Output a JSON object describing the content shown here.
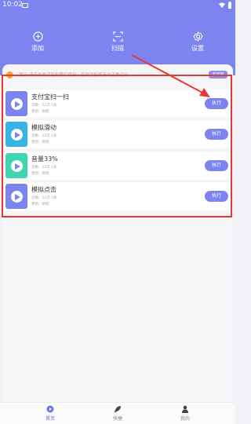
{
  "status_bar": {
    "time": "10:02"
  },
  "header": {
    "actions": [
      {
        "label": "添加",
        "icon": "plus-circle-icon"
      },
      {
        "label": "扫描",
        "icon": "scan-icon"
      },
      {
        "label": "设置",
        "icon": "gear-icon"
      }
    ]
  },
  "notice": {
    "text": "提示:请开启悬浮窗权限后使用，否则功能将无法正常运行",
    "button_label": "去开启"
  },
  "scripts": [
    {
      "title": "支付宝扫一扫",
      "meta1": "次数：12次  1条",
      "meta2": "更新：刚刚",
      "run_label": "执行",
      "thumb_color": "#7b84ef"
    },
    {
      "title": "模拟滑动",
      "meta1": "次数：12次  1条",
      "meta2": "更新：刚刚",
      "run_label": "执行",
      "thumb_color": "#37b4e6"
    },
    {
      "title": "音量33%",
      "meta1": "次数：12次  1条",
      "meta2": "更新：刚刚",
      "run_label": "执行",
      "thumb_color": "#3ed6b0"
    },
    {
      "title": "模拟点击",
      "meta1": "次数：12次  1条",
      "meta2": "更新：刚刚",
      "run_label": "执行",
      "thumb_color": "#7b84ef"
    }
  ],
  "bottom_nav": [
    {
      "label": "首页",
      "icon": "home-icon",
      "active": true
    },
    {
      "label": "快捷",
      "icon": "rocket-icon",
      "active": false
    },
    {
      "label": "我的",
      "icon": "user-icon",
      "active": false
    }
  ],
  "colors": {
    "accent": "#7b84ef",
    "highlight": "#e53935"
  }
}
